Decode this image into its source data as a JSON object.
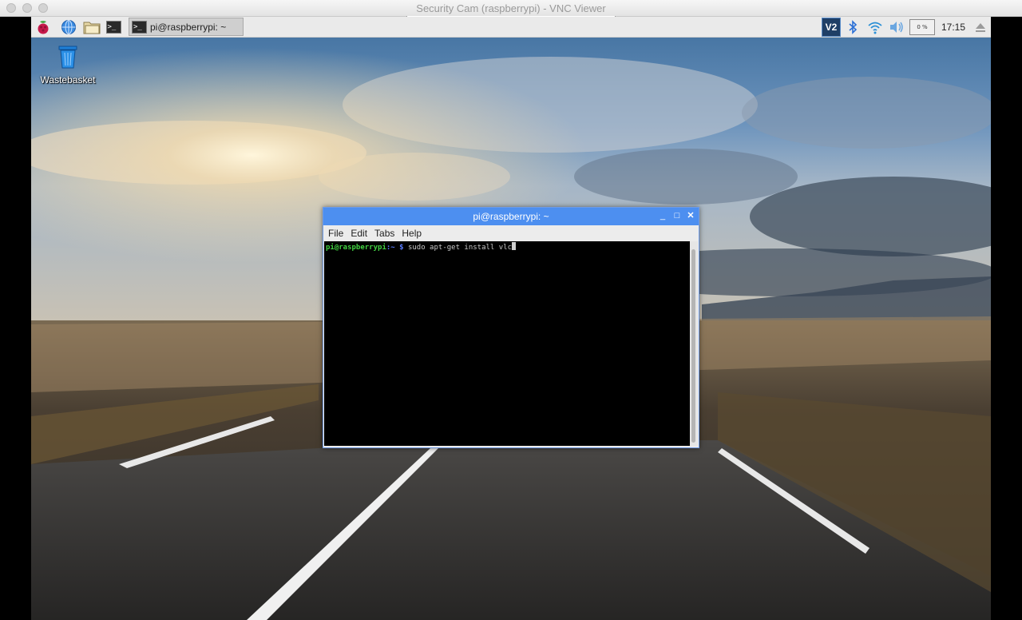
{
  "vnc_window": {
    "title": "Security Cam (raspberrypi) - VNC Viewer"
  },
  "panel": {
    "launchers": [
      "raspberry-menu-icon",
      "web-browser-icon",
      "file-manager-icon",
      "terminal-icon"
    ],
    "taskbar_button": {
      "label": "pi@raspberrypi: ~"
    },
    "tray": {
      "cpu_usage": "0 %",
      "clock": "17:15"
    }
  },
  "desktop": {
    "icons": [
      {
        "label": "Wastebasket",
        "icon": "trash-icon"
      }
    ]
  },
  "terminal": {
    "title": "pi@raspberrypi: ~",
    "menu": [
      "File",
      "Edit",
      "Tabs",
      "Help"
    ],
    "prompt_user": "pi@raspberrypi",
    "prompt_path": ":~ $",
    "command": "sudo apt-get install vlc"
  },
  "colors": {
    "panel_bg": "#eaeaea",
    "terminal_titlebar": "#4d8ff0",
    "prompt_user": "#43d443",
    "prompt_path": "#5a7cff"
  }
}
